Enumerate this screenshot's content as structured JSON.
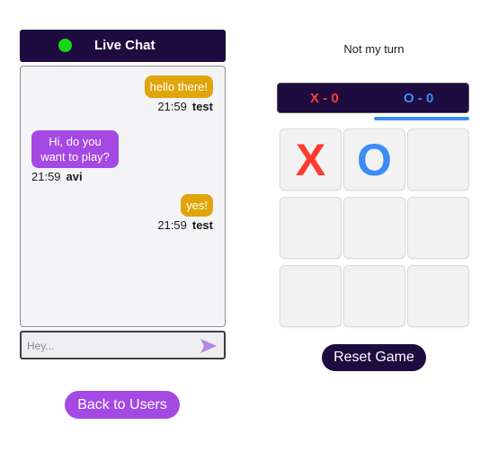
{
  "chat": {
    "title": "Live Chat",
    "online_color": "#17d417",
    "messages": [
      {
        "text": "hello there!",
        "time": "21:59",
        "user": "test",
        "side": "self"
      },
      {
        "text": "Hi, do you want to play?",
        "time": "21:59",
        "user": "avi",
        "side": "other"
      },
      {
        "text": "yes!",
        "time": "21:59",
        "user": "test",
        "side": "self"
      }
    ],
    "input": {
      "placeholder": "Hey...",
      "value": ""
    },
    "send_icon": "send-arrow-icon"
  },
  "nav": {
    "back_label": "Back to Users"
  },
  "game": {
    "status": "Not my turn",
    "score": {
      "x_label": "X - 0",
      "o_label": "O - 0"
    },
    "board": [
      "X",
      "O",
      "",
      "",
      "",
      "",
      "",
      "",
      ""
    ],
    "reset_label": "Reset Game"
  },
  "colors": {
    "header_bg": "#1e0b40",
    "self_bubble": "#dfa50a",
    "other_bubble": "#a449e3",
    "x_color": "#ff3b2f",
    "o_color": "#3b8df5"
  }
}
